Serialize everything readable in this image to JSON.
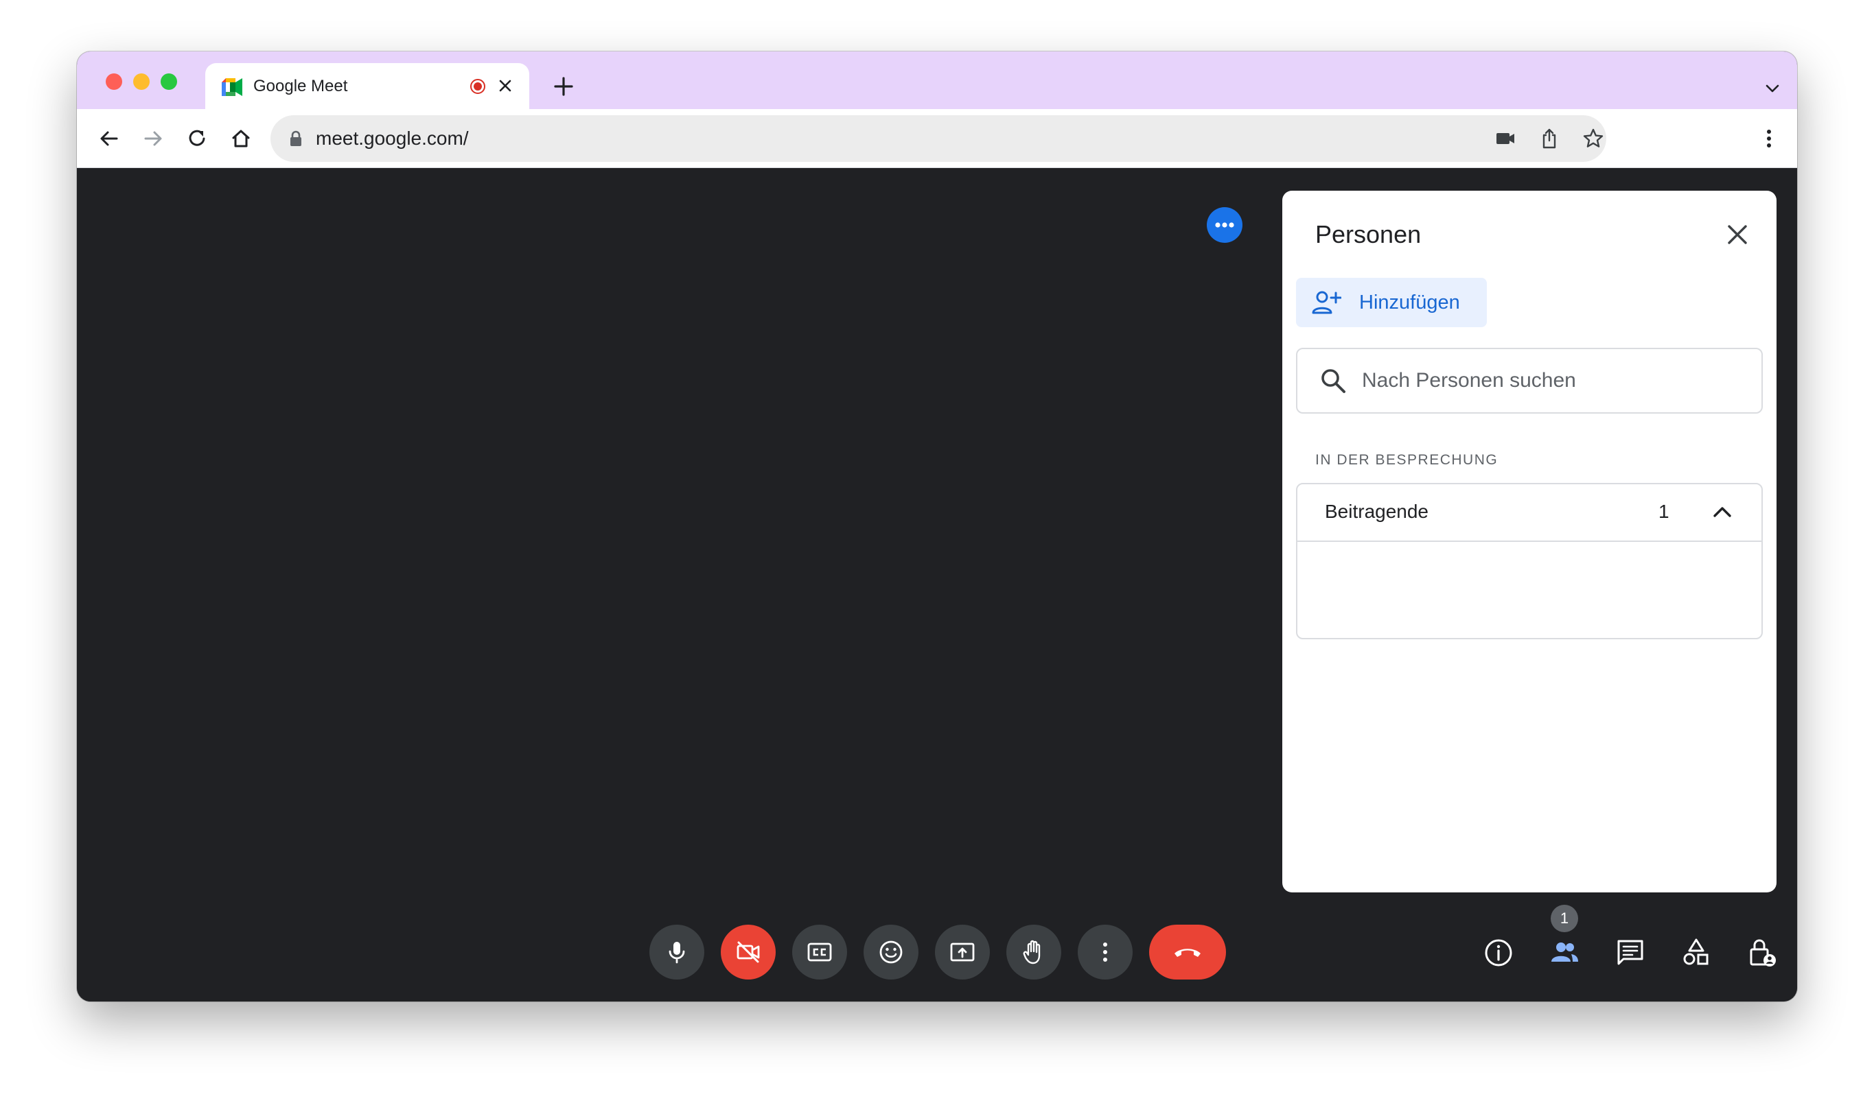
{
  "browser": {
    "tab_title": "Google Meet",
    "url": "meet.google.com/"
  },
  "panel": {
    "title": "Personen",
    "add_label": "Hinzufügen",
    "search_placeholder": "Nach Personen suchen",
    "section_label": "IN DER BESPRECHUNG",
    "group_name": "Beitragende",
    "group_count": "1"
  },
  "controls": {
    "participant_badge": "1",
    "camera_state": "off",
    "accent_colors": {
      "hangup": "#ea4335",
      "active": "#8ab4f8",
      "panel_button": "#1967d2"
    }
  },
  "icons": [
    "back-icon",
    "forward-icon",
    "reload-icon",
    "home-icon",
    "lock-icon",
    "camera-indicator-icon",
    "share-icon",
    "bookmark-star-icon",
    "more-vert-icon",
    "microphone-icon",
    "camera-off-icon",
    "captions-icon",
    "emoji-icon",
    "present-screen-icon",
    "raise-hand-icon",
    "hangup-icon",
    "info-icon",
    "people-icon",
    "chat-icon",
    "activities-icon",
    "host-controls-icon"
  ]
}
